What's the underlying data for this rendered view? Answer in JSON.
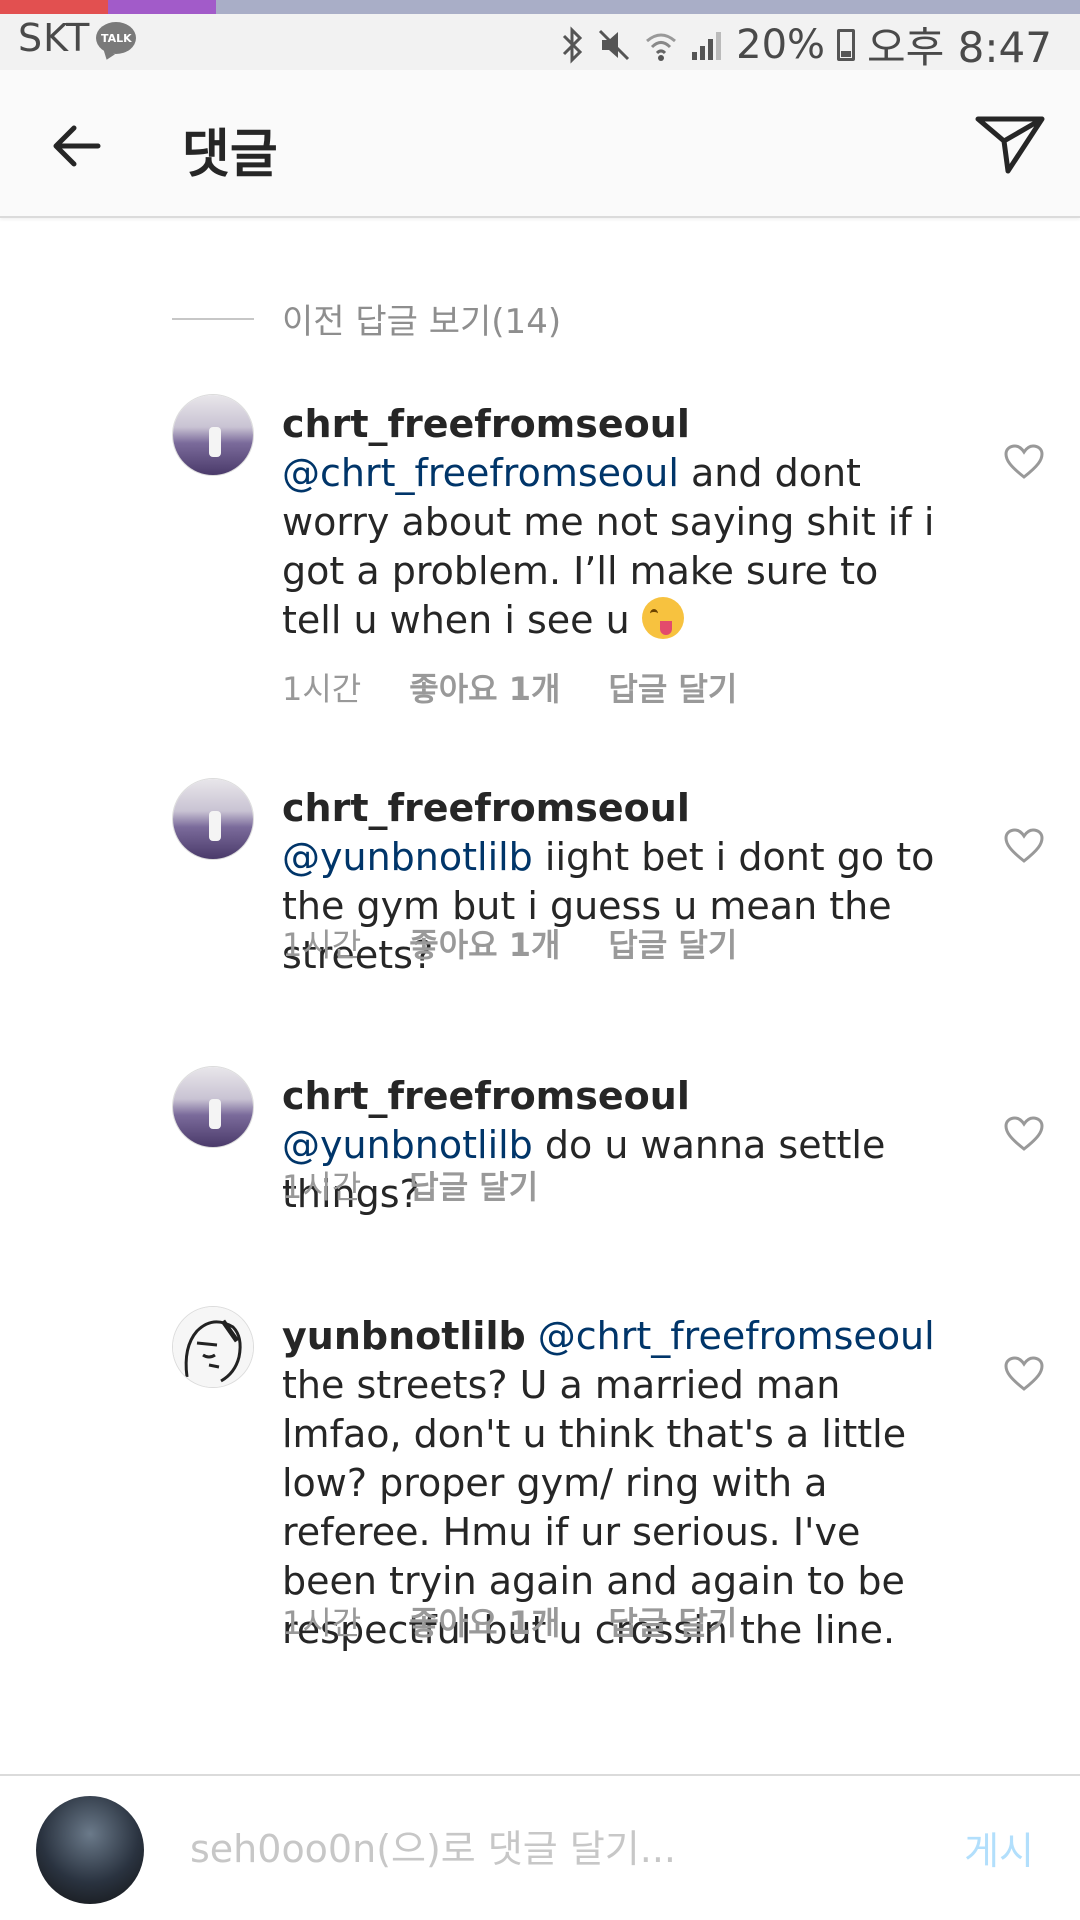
{
  "status_bar": {
    "carrier": "SKT",
    "talk_badge": "TALK",
    "battery_pct": "20%",
    "time": "오후 8:47",
    "icons": [
      "bluetooth-icon",
      "mute-icon",
      "wifi-icon",
      "signal-icon",
      "battery-icon"
    ]
  },
  "header": {
    "title": "댓글",
    "back_icon": "arrow-left-icon",
    "share_icon": "direct-send-icon"
  },
  "view_previous": "이전 답글 보기(14)",
  "comments": [
    {
      "username": "chrt_freefromseoul",
      "mention": "@chrt_freefromseoul",
      "text": " and dont worry about me not saying shit if i got a problem. I’ll make sure to tell u when i see u",
      "emoji": "winking-face-with-tongue",
      "time": "1시간",
      "likes": "좋아요 1개",
      "reply": "답글 달기"
    },
    {
      "username": "chrt_freefromseoul",
      "mention": "@yunbnotlilb",
      "text": "iight bet i dont go to the gym but i guess u mean the streets?",
      "time": "1시간",
      "likes": "좋아요 1개",
      "reply": "답글 달기"
    },
    {
      "username": "chrt_freefromseoul",
      "mention": "@yunbnotlilb",
      "text": "do u wanna settle things?",
      "time": "1시간",
      "reply": "답글 달기"
    },
    {
      "username": "yunbnotlilb",
      "mention": "@chrt_freefromseoul",
      "text": "the streets? U a married man lmfao, don't u think that's a little low? proper gym/ ring with a referee. Hmu if ur serious. I've been tryin again and again to be respectful but u crossin the line.",
      "time": "1시간",
      "likes": "좋아요 1개",
      "reply": "답글 달기"
    }
  ],
  "composer": {
    "placeholder": "seh0oo0n(으)로 댓글 달기...",
    "post_label": "게시"
  },
  "colors": {
    "mention": "#003569",
    "meta": "#999999",
    "post_disabled": "#b2dffc"
  }
}
